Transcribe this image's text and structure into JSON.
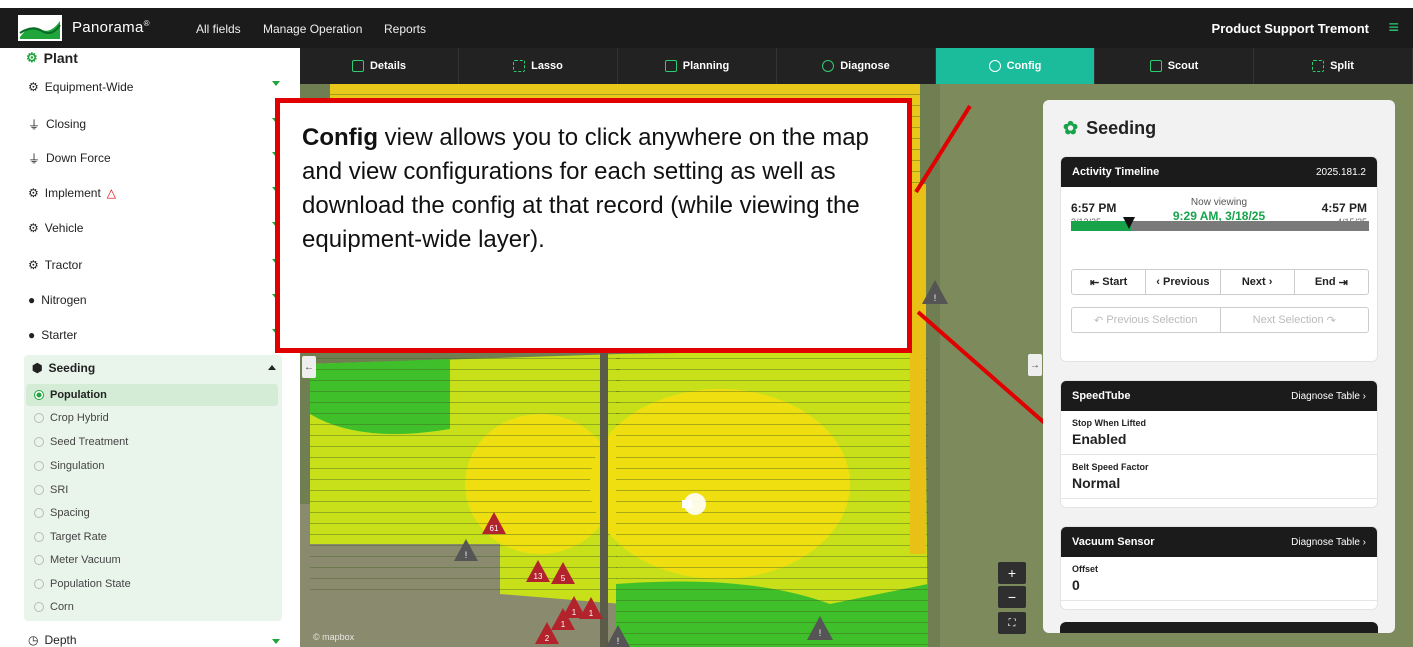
{
  "topnav": {
    "brand": "Panorama",
    "brand_mark": "®",
    "links": [
      "All fields",
      "Manage Operation",
      "Reports"
    ],
    "account": "Product Support Tremont"
  },
  "sidebar": {
    "title": "Plant",
    "groups": [
      "Equipment-Wide",
      "Closing",
      "Down Force",
      "Implement",
      "Vehicle",
      "Tractor",
      "Nitrogen",
      "Starter"
    ],
    "seeding": {
      "label": "Seeding",
      "options": [
        "Population",
        "Crop Hybrid",
        "Seed Treatment",
        "Singulation",
        "SRI",
        "Spacing",
        "Target Rate",
        "Meter Vacuum",
        "Population State",
        "Corn"
      ],
      "selected": "Population"
    },
    "depth": "Depth"
  },
  "tabs": [
    "Details",
    "Lasso",
    "Planning",
    "Diagnose",
    "Config",
    "Scout",
    "Split"
  ],
  "active_tab": "Config",
  "markers": [
    "61",
    "13",
    "5",
    "1",
    "1",
    "2",
    "1"
  ],
  "panel": {
    "title": "Seeding",
    "timeline": {
      "header": "Activity Timeline",
      "version": "2025.181.2",
      "start_time": "6:57 PM",
      "start_date": "3/12/25",
      "now_label": "Now viewing",
      "now_value": "9:29 AM, 3/18/25",
      "end_time": "4:57 PM",
      "end_date": "4/15/25",
      "progress": 0.2,
      "buttons": [
        "Start",
        "Previous",
        "Next",
        "End"
      ],
      "selection_buttons": [
        "Previous Selection",
        "Next Selection"
      ]
    },
    "speedtube": {
      "header": "SpeedTube",
      "link": "Diagnose Table",
      "items": [
        {
          "key": "Stop When Lifted",
          "value": "Enabled"
        },
        {
          "key": "Belt Speed Factor",
          "value": "Normal"
        }
      ]
    },
    "vacuum": {
      "header": "Vacuum Sensor",
      "link": "Diagnose Table",
      "items": [
        {
          "key": "Offset",
          "value": "0"
        }
      ]
    }
  },
  "map_controls": [
    "+",
    "−"
  ],
  "attribution": "© mapbox",
  "callout": {
    "bold": "Config",
    "text": " view allows you to click anywhere on the map and view configurations for each setting as well as download the config at that record (while viewing the equipment-wide layer)."
  },
  "colors": {
    "accent": "#1abc9c",
    "green": "#16a34a",
    "callout": "#e00000",
    "nav": "#1b1b1b"
  }
}
